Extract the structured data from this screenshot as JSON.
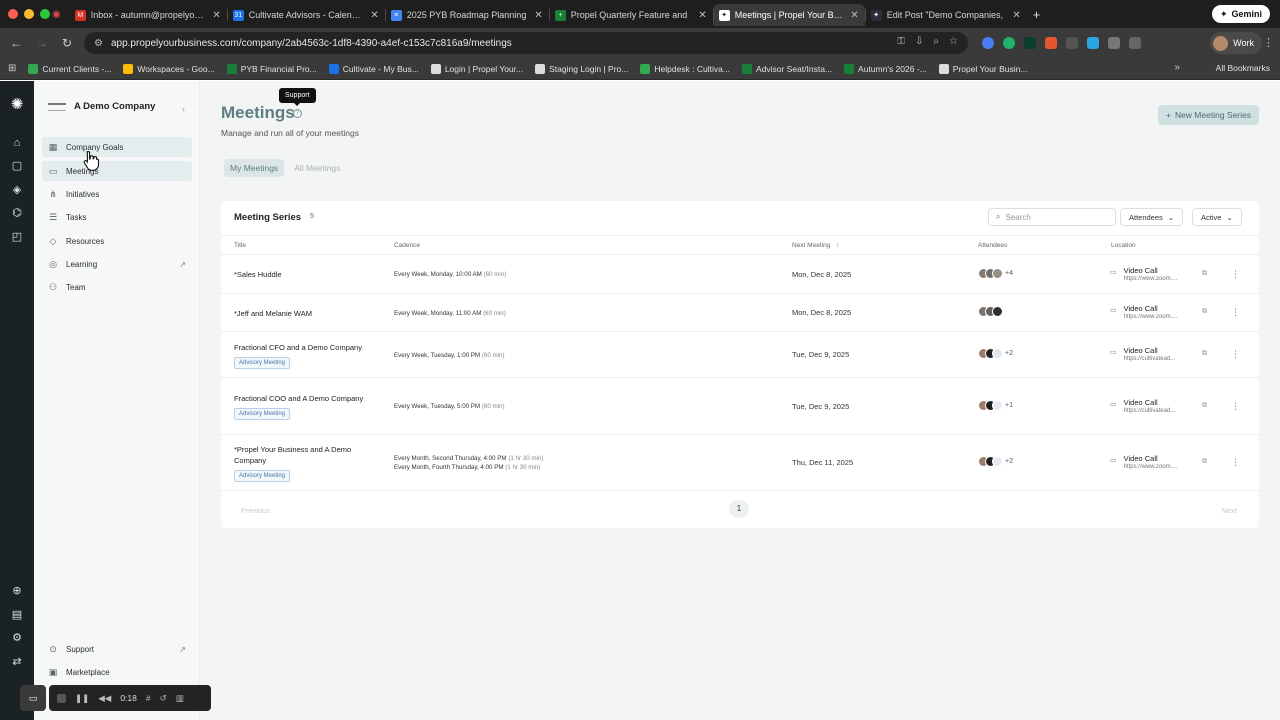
{
  "browser": {
    "tabs": [
      {
        "title": "Inbox - autumn@propelyourb",
        "fav": "#d93025",
        "glyph": "M"
      },
      {
        "title": "Cultivate Advisors - Calendar",
        "fav": "#1a73e8",
        "glyph": "31"
      },
      {
        "title": "2025 PYB Roadmap Planning",
        "fav": "#4285f4",
        "glyph": "≡"
      },
      {
        "title": "Propel Quarterly Feature and",
        "fav": "#188038",
        "glyph": "+"
      },
      {
        "title": "Meetings | Propel Your Busine",
        "fav": "#ffffff",
        "glyph": "✦",
        "active": true
      },
      {
        "title": "Edit Post \"Demo Companies,",
        "fav": "#2b2f3a",
        "glyph": "✦"
      }
    ],
    "new_tab": "+",
    "gemini": "Gemini",
    "url": "app.propelyourbusiness.com/company/2ab4563c-1df8-4390-a4ef-c153c7c816a9/meetings",
    "profile": "Work",
    "bookmarks": [
      {
        "label": "Current Clients -...",
        "color": "#34a853"
      },
      {
        "label": "Workspaces - Goo...",
        "color": "#fbbc04"
      },
      {
        "label": "PYB Financial Pro...",
        "color": "#188038"
      },
      {
        "label": "Cultivate - My Bus...",
        "color": "#1a73e8"
      },
      {
        "label": "Login | Propel Your...",
        "color": "#dddddd"
      },
      {
        "label": "Staging Login | Pro...",
        "color": "#dddddd"
      },
      {
        "label": "Helpdesk : Cultiva...",
        "color": "#34a853"
      },
      {
        "label": "Advisor Seat/Insta...",
        "color": "#188038"
      },
      {
        "label": "Autumn's 2026 -...",
        "color": "#188038"
      },
      {
        "label": "Propel Your Busin...",
        "color": "#dddddd"
      }
    ],
    "all_bookmarks": "All Bookmarks"
  },
  "sidebar": {
    "company": "A Demo Company",
    "items": [
      {
        "label": "Company Goals",
        "icon": "▦"
      },
      {
        "label": "Meetings",
        "icon": "▭"
      },
      {
        "label": "Initiatives",
        "icon": "⋔"
      },
      {
        "label": "Tasks",
        "icon": "☰"
      },
      {
        "label": "Resources",
        "icon": "◇"
      },
      {
        "label": "Learning",
        "icon": "◎"
      },
      {
        "label": "Team",
        "icon": "⚇"
      }
    ],
    "bottom": [
      {
        "label": "Support"
      },
      {
        "label": "Marketplace"
      }
    ]
  },
  "page": {
    "title": "Meetings",
    "tooltip": "Support",
    "subtitle": "Manage and run all of your meetings",
    "new_button": "New Meeting Series",
    "segments": [
      "My Meetings",
      "All Meetings"
    ]
  },
  "table": {
    "title": "Meeting Series",
    "count": "5",
    "search_placeholder": "Search",
    "filter_attendees": "Attendees",
    "filter_status": "Active",
    "columns": [
      "Title",
      "Cadence",
      "Next Meeting",
      "Attendees",
      "Location"
    ],
    "rows": [
      {
        "title": "*Sales Huddle",
        "badge": "",
        "cadence": [
          {
            "text": "Every Week, Monday, 10:00 AM",
            "dur": "(60 min)"
          }
        ],
        "next": "Mon, Dec 8, 2025",
        "more": "+4",
        "loc": "Video Call",
        "url": "https://www.zoom...."
      },
      {
        "title": "*Jeff and Melanie WAM",
        "badge": "",
        "cadence": [
          {
            "text": "Every Week, Monday, 11:00 AM",
            "dur": "(60 min)"
          }
        ],
        "next": "Mon, Dec 8, 2025",
        "more": "",
        "loc": "Video Call",
        "url": "https://www.zoom...."
      },
      {
        "title": "Fractional CFO and a Demo Company",
        "badge": "Advisory Meeting",
        "cadence": [
          {
            "text": "Every Week, Tuesday, 1:00 PM",
            "dur": "(60 min)"
          }
        ],
        "next": "Tue, Dec 9, 2025",
        "more": "+2",
        "loc": "Video Call",
        "url": "https://cultivatead..."
      },
      {
        "title": "Fractional COO and A Demo Company",
        "badge": "Advisory Meeting",
        "cadence": [
          {
            "text": "Every Week, Tuesday, 5:00 PM",
            "dur": "(60 min)"
          }
        ],
        "next": "Tue, Dec 9, 2025",
        "more": "+1",
        "loc": "Video Call",
        "url": "https://cultivatead..."
      },
      {
        "title": "*Propel Your Business and A Demo Company",
        "badge": "Advisory Meeting",
        "cadence": [
          {
            "text": "Every Month, Second Thursday, 4:00 PM",
            "dur": "(1 hr 30 min)"
          },
          {
            "text": "Every Month, Fourth Thursday, 4:00 PM",
            "dur": "(1 hr 30 min)"
          }
        ],
        "next": "Thu, Dec 11, 2025",
        "more": "+2",
        "loc": "Video Call",
        "url": "https://www.zoom...."
      }
    ],
    "pager": {
      "prev": "Previous",
      "page": "1",
      "next": "Next"
    }
  },
  "recorder": {
    "time": "0:18"
  }
}
